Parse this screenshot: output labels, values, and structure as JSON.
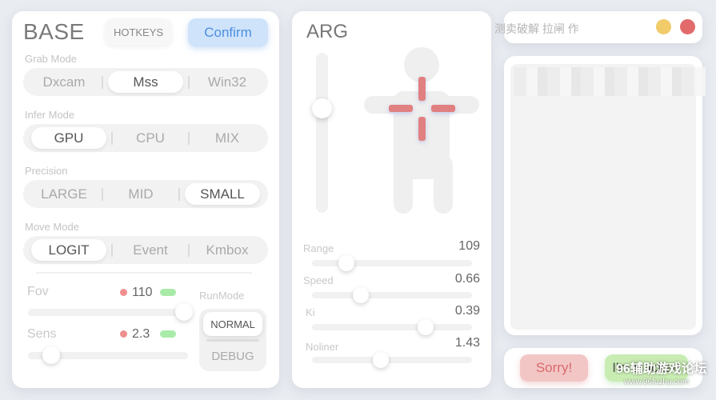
{
  "base": {
    "title": "BASE",
    "hotkeys_label": "HOTKEYS",
    "confirm_label": "Confirm",
    "grab_mode": {
      "label": "Grab Mode",
      "options": [
        "Dxcam",
        "Mss",
        "Win32"
      ],
      "selected": "Mss"
    },
    "infer_mode": {
      "label": "Infer Mode",
      "options": [
        "GPU",
        "CPU",
        "MIX"
      ],
      "selected": "GPU"
    },
    "precision": {
      "label": "Precision",
      "options": [
        "LARGE",
        "MID",
        "SMALL"
      ],
      "selected": "SMALL"
    },
    "move_mode": {
      "label": "Move Mode",
      "options": [
        "LOGIT",
        "Event",
        "Kmbox"
      ],
      "selected": "LOGIT"
    },
    "fov": {
      "label": "Fov",
      "value": "110"
    },
    "sens": {
      "label": "Sens",
      "value": "2.3"
    },
    "run_mode": {
      "label": "RunMode",
      "options": [
        "NORMAL",
        "DEBUG"
      ],
      "selected": "NORMAL"
    }
  },
  "arg": {
    "title": "ARG",
    "params": [
      {
        "label": "Range",
        "value": "109"
      },
      {
        "label": "Speed",
        "value": "0.66"
      },
      {
        "label": "Ki",
        "value": "0.39"
      },
      {
        "label": "Noliner",
        "value": "1.43"
      }
    ]
  },
  "titlebar": {
    "text": "测卖破解 拉闸 作",
    "minimize_color": "#f2cb6a",
    "close_color": "#e36a6a"
  },
  "actions": {
    "sorry_label": "Sorry!",
    "hacker_label": "I'm Hacker!"
  },
  "watermark": {
    "text": "96辅助游戏论坛",
    "url": "www.96fuzhu.com"
  },
  "colors": {
    "accent_blue": "#4d8fe0",
    "cross_red": "#e18080",
    "dot_red": "#f08f8f",
    "pill_green": "#a8eba8"
  }
}
